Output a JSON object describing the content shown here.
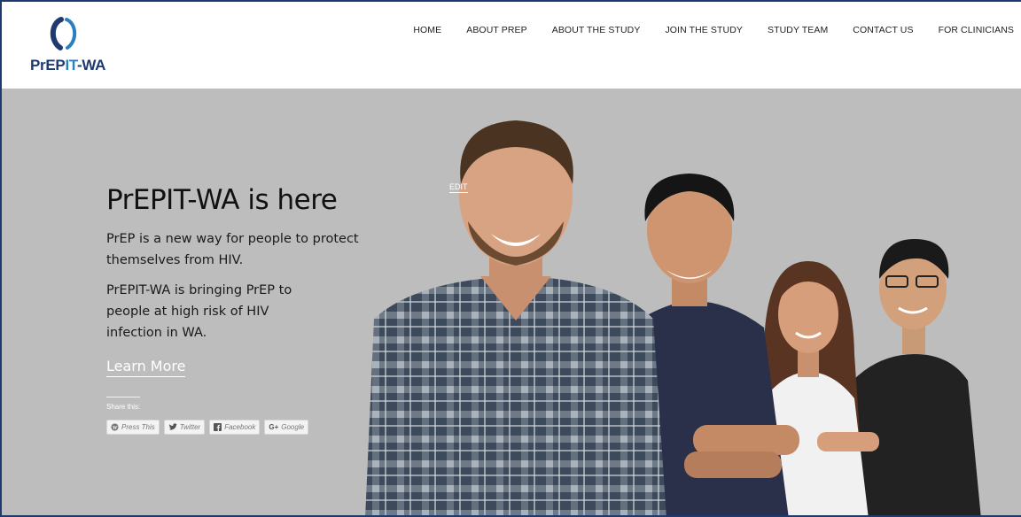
{
  "brand": {
    "logo_text_part1": "PrEP",
    "logo_text_part2": "IT",
    "logo_text_part3": "-WA",
    "primary_color": "#1f3a6e",
    "accent_color": "#2a7fc1"
  },
  "nav": {
    "items": [
      {
        "label": "HOME"
      },
      {
        "label": "ABOUT PREP"
      },
      {
        "label": "ABOUT THE STUDY"
      },
      {
        "label": "JOIN THE STUDY"
      },
      {
        "label": "STUDY TEAM"
      },
      {
        "label": "CONTACT US"
      },
      {
        "label": "FOR CLINICIANS"
      }
    ]
  },
  "hero": {
    "title": "PrEPIT-WA is here",
    "paragraph1": "PrEP is a new way for people to protect themselves from HIV.",
    "paragraph2": "PrEPIT-WA is bringing PrEP to people at high risk of HIV infection in WA.",
    "learn_more": "Learn More",
    "edit_label": "EDIT",
    "background_color": "#bdbdbd"
  },
  "share": {
    "label": "Share this:",
    "buttons": [
      {
        "label": "Press This",
        "icon": "wordpress-icon"
      },
      {
        "label": "Twitter",
        "icon": "twitter-icon"
      },
      {
        "label": "Facebook",
        "icon": "facebook-icon"
      },
      {
        "label": "Google",
        "icon": "google-plus-icon"
      }
    ]
  }
}
